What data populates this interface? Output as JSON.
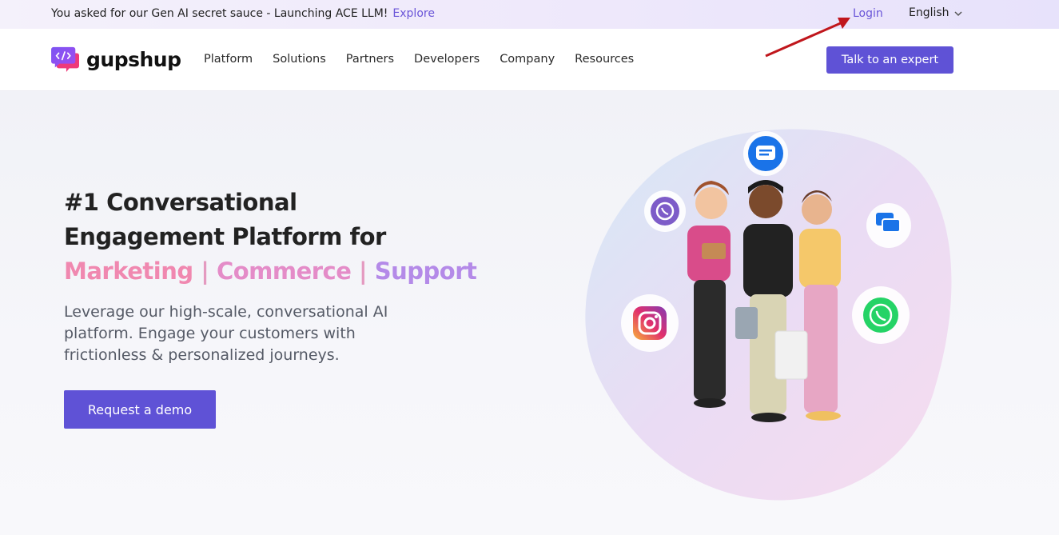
{
  "topbar": {
    "announcement": "You asked for our Gen AI secret sauce - Launching ACE LLM!",
    "explore_label": "Explore",
    "login_label": "Login",
    "language_label": "English"
  },
  "nav": {
    "brand": "gupshup",
    "menu": [
      "Platform",
      "Solutions",
      "Partners",
      "Developers",
      "Company",
      "Resources"
    ],
    "cta_label": "Talk to an expert"
  },
  "hero": {
    "headline_line1": "#1 Conversational",
    "headline_line2": "Engagement Platform for",
    "tag_marketing": "Marketing",
    "tag_commerce": "Commerce",
    "tag_support": "Support",
    "separator": "|",
    "description": "Leverage our high-scale, conversational AI platform. Engage your customers with frictionless & personalized journeys.",
    "demo_label": "Request a demo"
  },
  "colors": {
    "primary": "#5f52d6",
    "link": "#6a55d8",
    "tag_pink": "#f088b0",
    "tag_purple": "#b48ae8",
    "annotation_arrow": "#c0161c"
  },
  "icons": [
    "messages-icon",
    "viber-icon",
    "chat-icon",
    "instagram-icon",
    "whatsapp-icon"
  ]
}
